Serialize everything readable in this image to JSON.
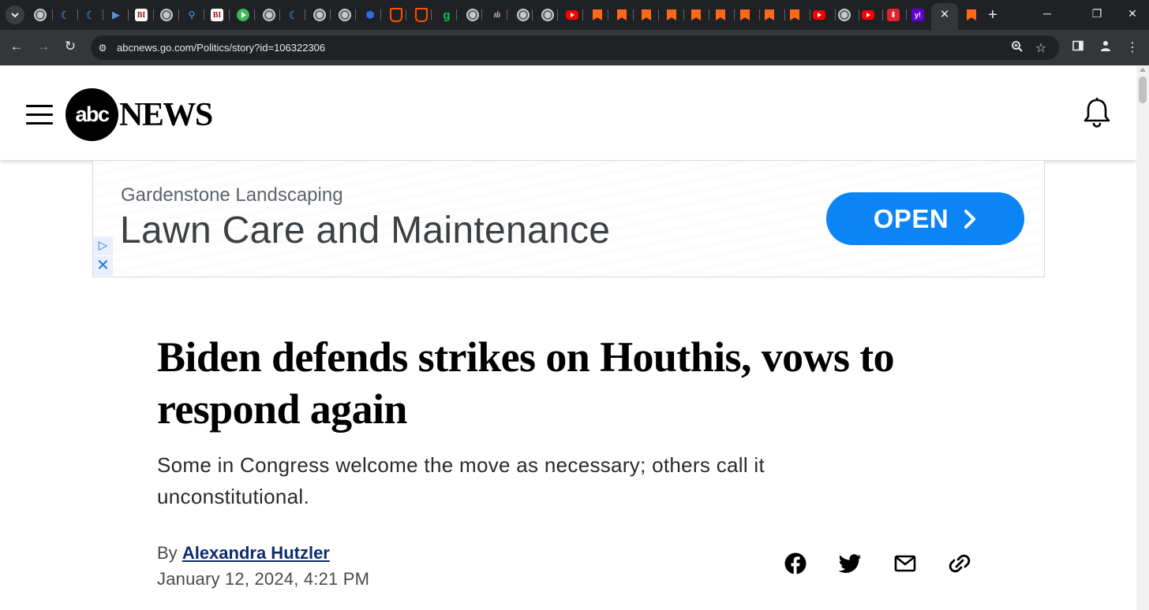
{
  "browser": {
    "url": "abcnews.go.com/Politics/story?id=106322306",
    "tab_close": "✕",
    "new_tab": "+"
  },
  "ad": {
    "advertiser": "Gardenstone Landscaping",
    "headline": "Lawn Care and Maintenance",
    "cta_label": "OPEN",
    "cta_color": "#0b84f5"
  },
  "header": {
    "logo_circle": "abc",
    "logo_word": "NEWS"
  },
  "article": {
    "title": "Biden defends strikes on Houthis, vows to respond again",
    "subtitle": "Some in Congress welcome the move as necessary; others call it unconstitutional.",
    "by": "By",
    "author": "Alexandra Hutzler",
    "date": "January 12, 2024, 4:21 PM"
  },
  "share_icons": [
    "facebook-icon",
    "twitter-icon",
    "email-icon",
    "link-icon"
  ],
  "tab_favicons": [
    "globe",
    "shield",
    "shield",
    "arrow",
    "bi",
    "globe",
    "magnifier",
    "bi",
    "play",
    "globe",
    "shield",
    "globe",
    "globe",
    "cube",
    "brave",
    "brave",
    "g",
    "globe",
    "slash",
    "globe",
    "globe",
    "youtube",
    "substack",
    "substack",
    "substack",
    "substack",
    "substack",
    "substack",
    "substack",
    "substack",
    "substack",
    "youtube",
    "globe",
    "youtube",
    "red",
    "yahoo"
  ]
}
